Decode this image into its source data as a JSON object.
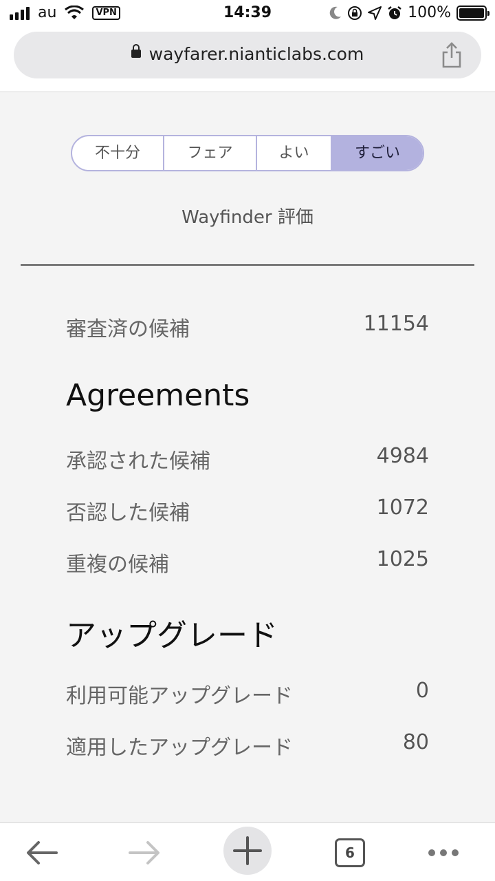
{
  "status_bar": {
    "carrier": "au",
    "vpn_label": "VPN",
    "time": "14:39",
    "battery": "100%"
  },
  "browser": {
    "url": "wayfarer.nianticlabs.com",
    "tab_count": "6"
  },
  "rating": {
    "options": [
      "不十分",
      "フェア",
      "よい",
      "すごい"
    ],
    "selected": "すごい",
    "label": "Wayfinder 評価"
  },
  "reviewed": {
    "label": "審査済の候補",
    "value": "11154"
  },
  "agreements": {
    "title": "Agreements",
    "rows": [
      {
        "label": "承認された候補",
        "value": "4984"
      },
      {
        "label": "否認した候補",
        "value": "1072"
      },
      {
        "label": "重複の候補",
        "value": "1025"
      }
    ]
  },
  "upgrades": {
    "title": "アップグレード",
    "rows": [
      {
        "label": "利用可能アップグレード",
        "value": "0"
      },
      {
        "label": "適用したアップグレード",
        "value": "80"
      }
    ]
  },
  "icons": {
    "back": "arrow-left-icon",
    "forward": "arrow-right-icon",
    "new_tab": "plus-icon",
    "tabs": "tabs-icon",
    "more": "more-dots-icon",
    "share": "share-icon",
    "lock": "lock-icon"
  }
}
